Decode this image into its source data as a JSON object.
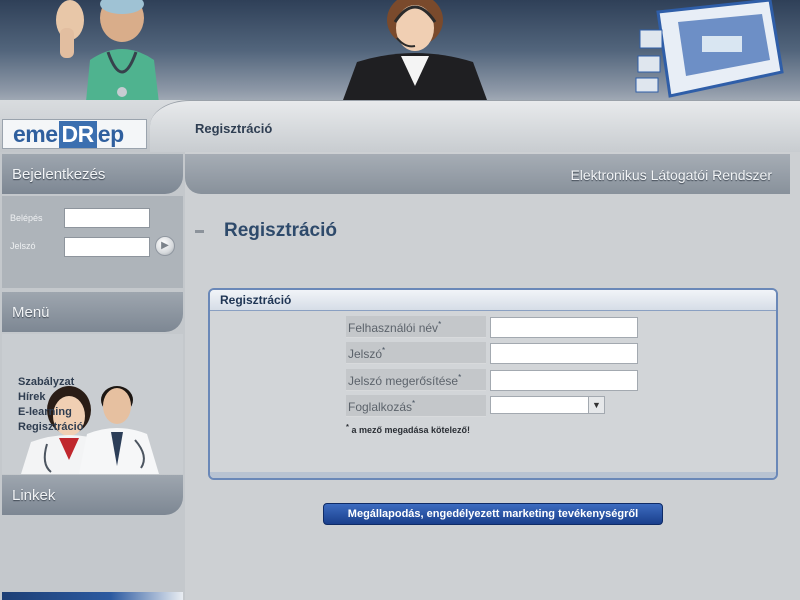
{
  "header": {
    "logo": {
      "part1": "eme",
      "part2": "DR",
      "part3": "ep"
    },
    "breadcrumb": "Regisztráció"
  },
  "sidebar": {
    "login": {
      "title": "Bejelentkezés",
      "username_label": "Belépés",
      "password_label": "Jelszó",
      "username_value": "",
      "password_value": ""
    },
    "menu": {
      "title": "Menü"
    },
    "links": {
      "title": "Linkek",
      "items": [
        {
          "label": "Szabályzat"
        },
        {
          "label": "Hírek"
        },
        {
          "label": "E-learning"
        },
        {
          "label": "Regisztráció"
        }
      ]
    }
  },
  "main": {
    "system_title": "Elektronikus Látogatói Rendszer",
    "page_title": "Regisztráció",
    "form": {
      "title": "Regisztráció",
      "fields": {
        "username_label": "Felhasználói név",
        "password_label": "Jelszó",
        "confirm_label": "Jelszó megerősítése",
        "occupation_label": "Foglalkozás",
        "required_mark": "*"
      },
      "values": {
        "username": "",
        "password": "",
        "confirm": "",
        "occupation": ""
      },
      "required_note": "a mező megadása kötelező!"
    },
    "agreement_button": "Megállapodás, engedélyezett marketing tevékenységről"
  },
  "colors": {
    "accent": "#2e4a6b",
    "button_blue": "#1a3f8c",
    "logo_blue": "#3b6fb0",
    "form_border": "#6a88b8"
  }
}
